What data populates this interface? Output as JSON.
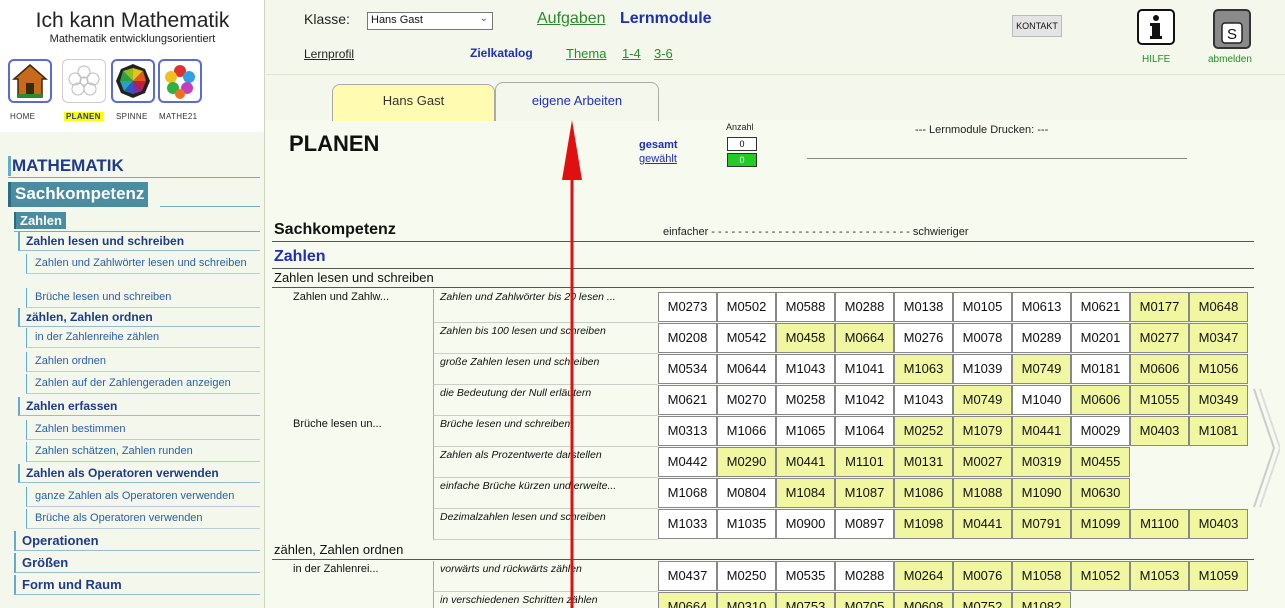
{
  "app": {
    "title": "Ich kann Mathematik",
    "subtitle": "Mathematik entwicklungsorientiert"
  },
  "modules": [
    {
      "label": "HOME",
      "icon": "home-icon"
    },
    {
      "label": "PLANEN",
      "icon": "planen-icon"
    },
    {
      "label": "SPINNE",
      "icon": "spinne-icon"
    },
    {
      "label": "MATHE21",
      "icon": "mathe21-icon"
    }
  ],
  "header": {
    "klasse_label": "Klasse:",
    "klasse_value": "Hans Gast",
    "aufgaben": "Aufgaben",
    "lernmodule": "Lernmodule",
    "lernprofil": "Lernprofil",
    "zielkatalog": "Zielkatalog",
    "thema": "Thema",
    "range_1_4": "1-4",
    "range_3_6": "3-6",
    "kontakt": "KONTAKT",
    "hilfe": "HILFE",
    "abmelden": "abmelden"
  },
  "tabs": [
    {
      "label": "Hans Gast"
    },
    {
      "label": "eigene Arbeiten"
    }
  ],
  "nav": {
    "mathematik": "MATHEMATIK",
    "sachkompetenz": "Sachkompetenz",
    "zahlen": "Zahlen",
    "items": [
      {
        "type": "sub",
        "label": "Zahlen lesen und schreiben"
      },
      {
        "type": "leaf",
        "label": "Zahlen und Zahlwörter lesen und schreiben"
      },
      {
        "type": "leaf",
        "label": "Brüche lesen und schreiben"
      },
      {
        "type": "sub",
        "label": "zählen, Zahlen ordnen"
      },
      {
        "type": "leaf",
        "label": "in der Zahlenreihe zählen"
      },
      {
        "type": "leaf",
        "label": "Zahlen ordnen"
      },
      {
        "type": "leaf",
        "label": "Zahlen auf der Zahlengeraden anzeigen"
      },
      {
        "type": "sub",
        "label": "Zahlen erfassen"
      },
      {
        "type": "leaf",
        "label": "Zahlen bestimmen"
      },
      {
        "type": "leaf",
        "label": "Zahlen schätzen, Zahlen runden"
      },
      {
        "type": "sub",
        "label": "Zahlen als Operatoren verwenden"
      },
      {
        "type": "leaf",
        "label": "ganze Zahlen als Operatoren verwenden"
      },
      {
        "type": "leaf",
        "label": "Brüche als Operatoren verwenden"
      },
      {
        "type": "top",
        "label": "Operationen"
      },
      {
        "type": "top",
        "label": "Größen"
      },
      {
        "type": "top",
        "label": "Form und Raum"
      }
    ]
  },
  "content": {
    "title": "PLANEN",
    "anzahl": "Anzahl",
    "gesamt_label": "gesamt",
    "gesamt_value": "0",
    "gewaehlt_label": "gewählt",
    "gewaehlt_value": "0",
    "drucken": "--- Lernmodule Drucken: ---",
    "section": "Sachkompetenz",
    "scale": "einfacher - - - - - - - - - - - - - - - - - - - - - - - - - - - - - - schwieriger",
    "topic": "Zahlen",
    "groups": [
      {
        "title": "Zahlen lesen und schreiben",
        "rows": [
          {
            "cat": "Zahlen und Zahlw...",
            "goal": "Zahlen und Zahlwörter bis 20 lesen ...",
            "mods": [
              [
                "M0273",
                "w"
              ],
              [
                "M0502",
                "w"
              ],
              [
                "M0588",
                "w"
              ],
              [
                "M0288",
                "w"
              ],
              [
                "M0138",
                "w"
              ],
              [
                "M0105",
                "w"
              ],
              [
                "M0613",
                "w"
              ],
              [
                "M0621",
                "w"
              ],
              [
                "M0177",
                "y"
              ],
              [
                "M0648",
                "y"
              ]
            ]
          },
          {
            "cat": "",
            "goal": "Zahlen bis 100 lesen und schreiben",
            "mods": [
              [
                "M0208",
                "w"
              ],
              [
                "M0542",
                "w"
              ],
              [
                "M0458",
                "y"
              ],
              [
                "M0664",
                "y"
              ],
              [
                "M0276",
                "w"
              ],
              [
                "M0078",
                "w"
              ],
              [
                "M0289",
                "w"
              ],
              [
                "M0201",
                "w"
              ],
              [
                "M0277",
                "y"
              ],
              [
                "M0347",
                "y"
              ]
            ]
          },
          {
            "cat": "",
            "goal": "große Zahlen lesen und schreiben",
            "mods": [
              [
                "M0534",
                "w"
              ],
              [
                "M0644",
                "w"
              ],
              [
                "M1043",
                "w"
              ],
              [
                "M1041",
                "w"
              ],
              [
                "M1063",
                "y"
              ],
              [
                "M1039",
                "w"
              ],
              [
                "M0749",
                "y"
              ],
              [
                "M0181",
                "w"
              ],
              [
                "M0606",
                "y"
              ],
              [
                "M1056",
                "y"
              ]
            ]
          },
          {
            "cat": "",
            "goal": "die Bedeutung der Null erläutern",
            "mods": [
              [
                "M0621",
                "w"
              ],
              [
                "M0270",
                "w"
              ],
              [
                "M0258",
                "w"
              ],
              [
                "M1042",
                "w"
              ],
              [
                "M1043",
                "w"
              ],
              [
                "M0749",
                "y"
              ],
              [
                "M1040",
                "w"
              ],
              [
                "M0606",
                "y"
              ],
              [
                "M1055",
                "y"
              ],
              [
                "M0349",
                "y"
              ]
            ]
          },
          {
            "cat": "Brüche lesen un...",
            "goal": "Brüche lesen und schreiben",
            "mods": [
              [
                "M0313",
                "w"
              ],
              [
                "M1066",
                "w"
              ],
              [
                "M1065",
                "w"
              ],
              [
                "M1064",
                "w"
              ],
              [
                "M0252",
                "y"
              ],
              [
                "M1079",
                "y"
              ],
              [
                "M0441",
                "y"
              ],
              [
                "M0029",
                "w"
              ],
              [
                "M0403",
                "y"
              ],
              [
                "M1081",
                "y"
              ]
            ]
          },
          {
            "cat": "",
            "goal": "Zahlen als Prozentwerte darstellen",
            "mods": [
              [
                "M0442",
                "w"
              ],
              [
                "M0290",
                "y"
              ],
              [
                "M0441",
                "y"
              ],
              [
                "M1101",
                "y"
              ],
              [
                "M0131",
                "y"
              ],
              [
                "M0027",
                "y"
              ],
              [
                "M0319",
                "y"
              ],
              [
                "M0455",
                "y"
              ]
            ]
          },
          {
            "cat": "",
            "goal": "einfache Brüche kürzen und erweite...",
            "mods": [
              [
                "M1068",
                "w"
              ],
              [
                "M0804",
                "w"
              ],
              [
                "M1084",
                "y"
              ],
              [
                "M1087",
                "y"
              ],
              [
                "M1086",
                "y"
              ],
              [
                "M1088",
                "y"
              ],
              [
                "M1090",
                "y"
              ],
              [
                "M0630",
                "y"
              ]
            ]
          },
          {
            "cat": "",
            "goal": "Dezimalzahlen lesen und schreiben",
            "mods": [
              [
                "M1033",
                "w"
              ],
              [
                "M1035",
                "w"
              ],
              [
                "M0900",
                "w"
              ],
              [
                "M0897",
                "w"
              ],
              [
                "M1098",
                "y"
              ],
              [
                "M0441",
                "y"
              ],
              [
                "M0791",
                "y"
              ],
              [
                "M1099",
                "y"
              ],
              [
                "M1100",
                "y"
              ],
              [
                "M0403",
                "y"
              ]
            ]
          }
        ]
      },
      {
        "title": "zählen, Zahlen ordnen",
        "rows": [
          {
            "cat": "in der Zahlenrei...",
            "goal": "vorwärts und rückwärts zählen",
            "mods": [
              [
                "M0437",
                "w"
              ],
              [
                "M0250",
                "w"
              ],
              [
                "M0535",
                "w"
              ],
              [
                "M0288",
                "w"
              ],
              [
                "M0264",
                "y"
              ],
              [
                "M0076",
                "y"
              ],
              [
                "M1058",
                "y"
              ],
              [
                "M1052",
                "y"
              ],
              [
                "M1053",
                "y"
              ],
              [
                "M1059",
                "y"
              ]
            ]
          },
          {
            "cat": "",
            "goal": "in verschiedenen Schritten zählen",
            "mods": [
              [
                "M0664",
                "y"
              ],
              [
                "M0310",
                "y"
              ],
              [
                "M0753",
                "y"
              ],
              [
                "M0705",
                "y"
              ],
              [
                "M0608",
                "y"
              ],
              [
                "M0752",
                "y"
              ],
              [
                "M1082",
                "y"
              ]
            ]
          }
        ]
      }
    ]
  },
  "colors": {
    "accent": "#1e2fb4",
    "link_green": "#2a8a2a",
    "cell_yellow": "#f1f6a0",
    "nav_selected": "#4a8ca0",
    "annotation_arrow": "#e01010"
  }
}
